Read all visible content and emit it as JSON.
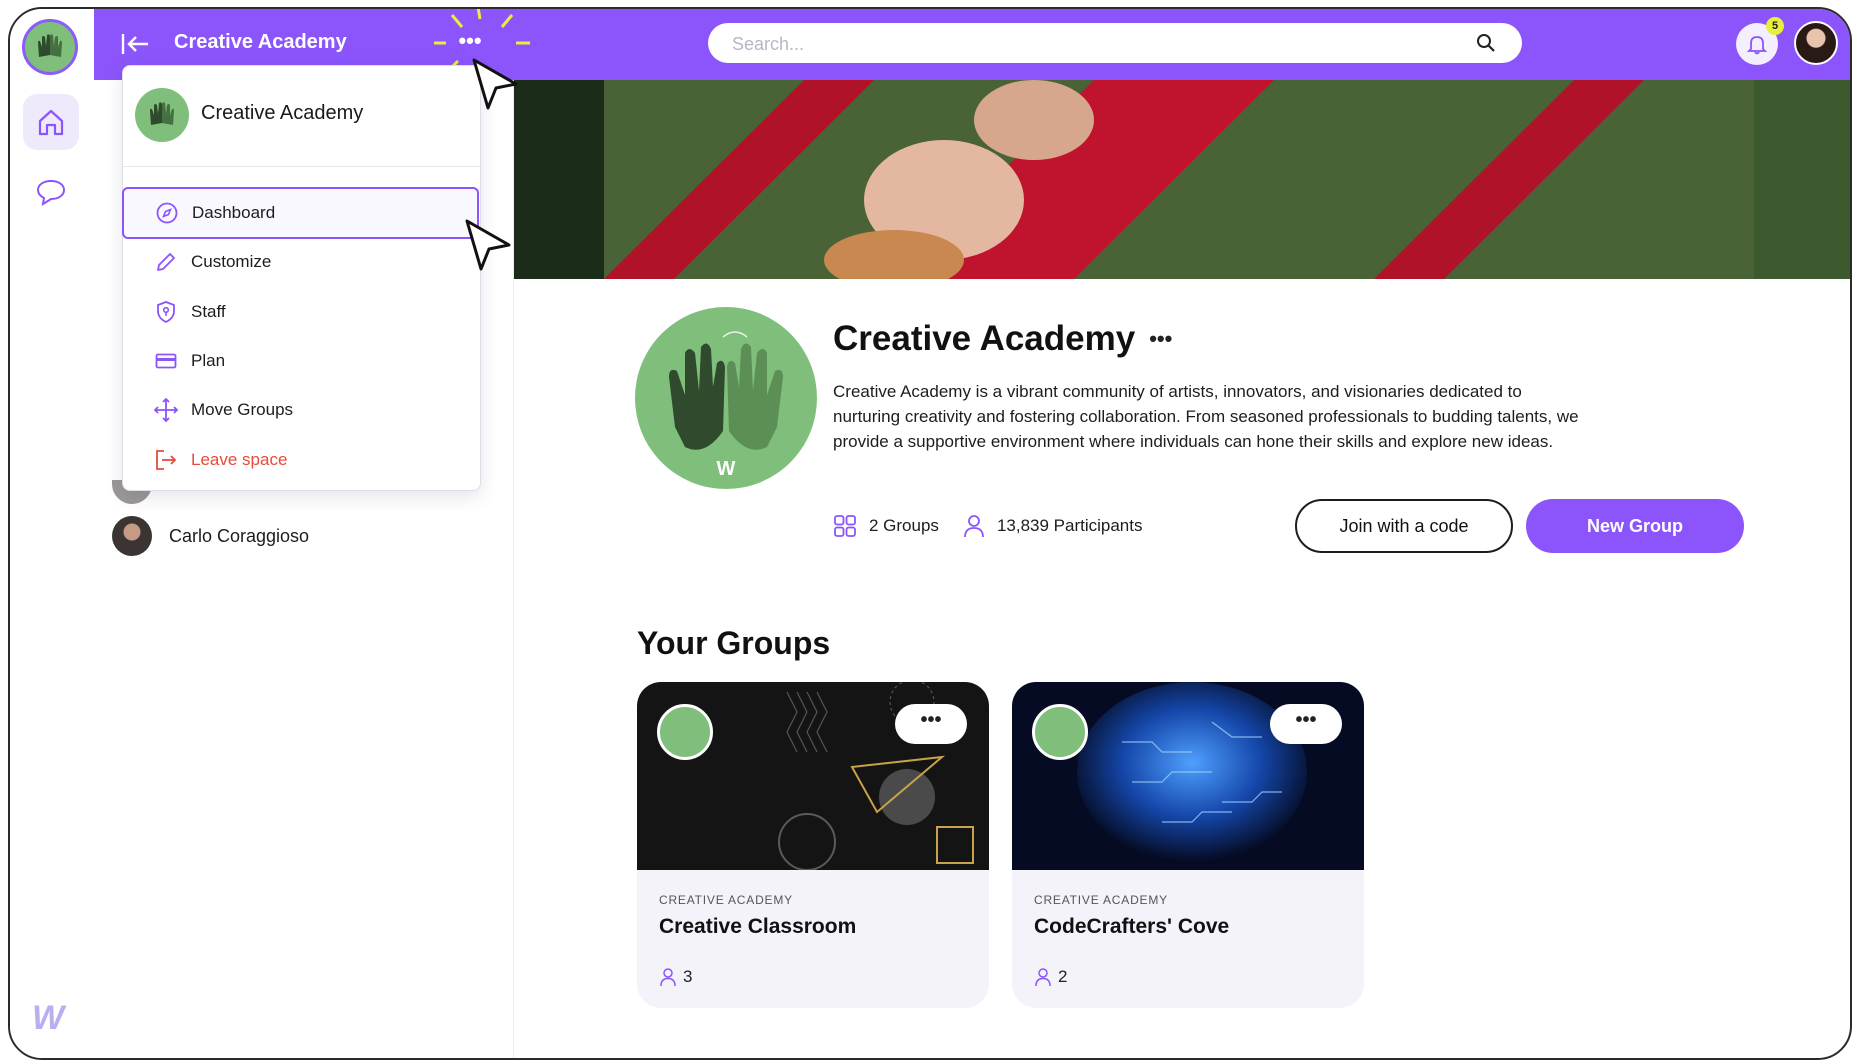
{
  "rail": {
    "logo_letter": "W"
  },
  "topbar": {
    "space_title": "Creative Academy",
    "more_label": "•••",
    "search_placeholder": "Search...",
    "notifications": "5"
  },
  "menu": {
    "header_title": "Creative Academy",
    "items": [
      {
        "label": "Dashboard",
        "icon": "compass-icon"
      },
      {
        "label": "Customize",
        "icon": "pencil-icon"
      },
      {
        "label": "Staff",
        "icon": "shield-icon"
      },
      {
        "label": "Plan",
        "icon": "credit-card-icon"
      },
      {
        "label": "Move Groups",
        "icon": "move-icon"
      },
      {
        "label": "Leave space",
        "icon": "exit-icon"
      }
    ]
  },
  "sidebar": {
    "member_name": "Carlo Coraggioso"
  },
  "main": {
    "title": "Creative Academy",
    "title_more": "•••",
    "logo_letter": "W",
    "description": "Creative Academy is a vibrant community of artists, innovators, and visionaries dedicated to nurturing creativity and fostering collaboration. From seasoned professionals to budding talents, we provide a supportive environment where individuals can hone their skills and explore new ideas.",
    "groups_count": "2 Groups",
    "participants_count": "13,839 Participants",
    "join_label": "Join with a code",
    "new_group_label": "New Group",
    "section_title": "Your Groups"
  },
  "groups": [
    {
      "space": "CREATIVE ACADEMY",
      "name": "Creative Classroom",
      "members": "3",
      "more": "•••"
    },
    {
      "space": "CREATIVE ACADEMY",
      "name": "CodeCrafters' Cove",
      "members": "2",
      "more": "•••"
    }
  ],
  "colors": {
    "brand": "#8b55fb",
    "danger": "#e84a3c",
    "logo_green": "#7fbf7b"
  }
}
